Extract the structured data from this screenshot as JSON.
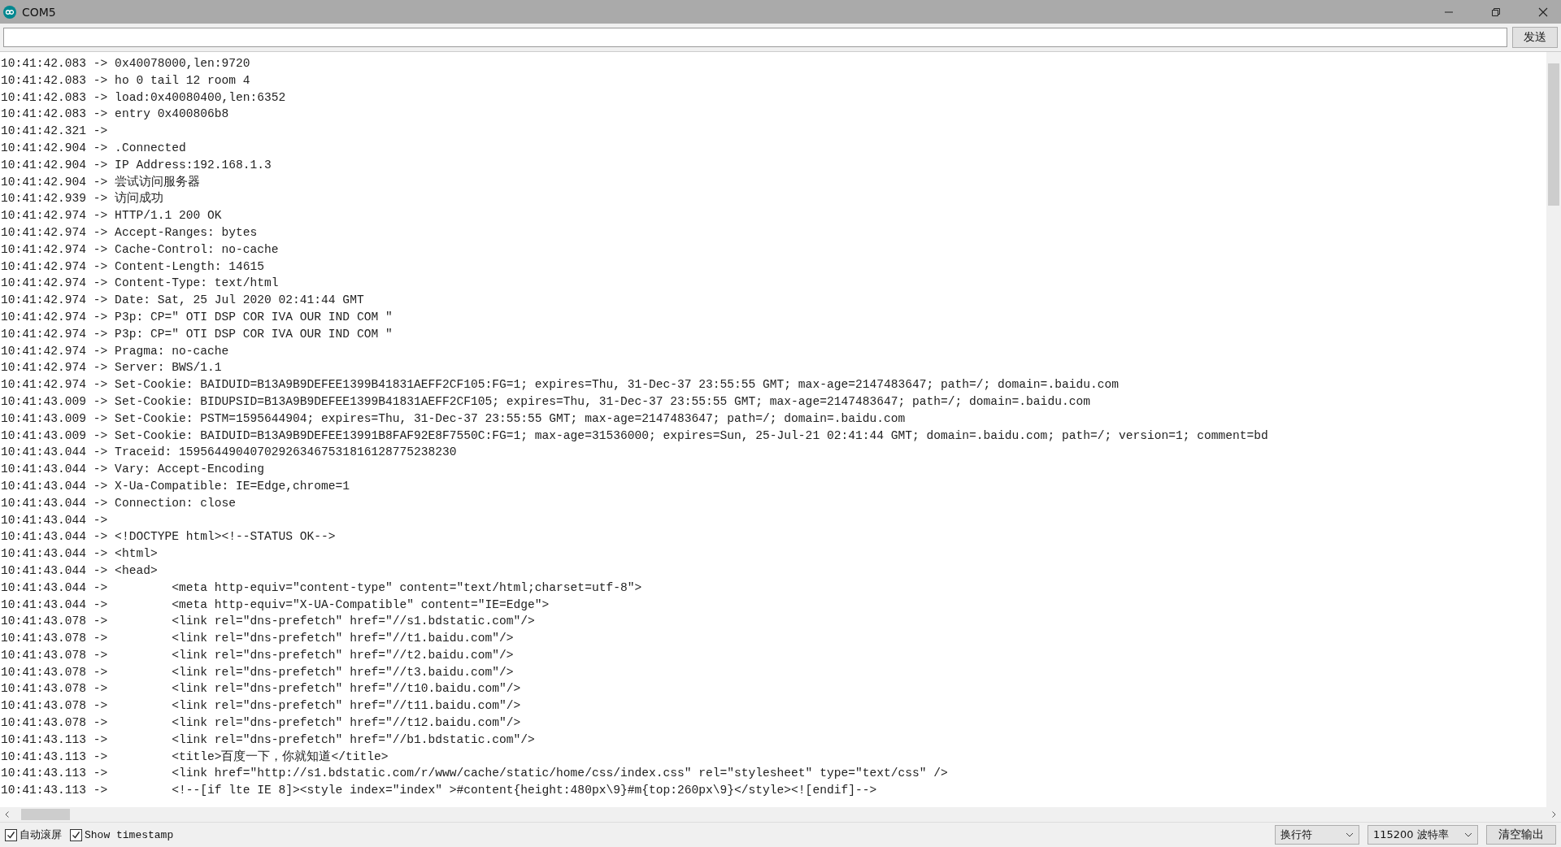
{
  "window": {
    "title": "COM5"
  },
  "input": {
    "send_button": "发送"
  },
  "output_lines": [
    "10:41:42.083 -> 0x40078000,len:9720",
    "10:41:42.083 -> ho 0 tail 12 room 4",
    "10:41:42.083 -> load:0x40080400,len:6352",
    "10:41:42.083 -> entry 0x400806b8",
    "10:41:42.321 ->",
    "10:41:42.904 -> .Connected",
    "10:41:42.904 -> IP Address:192.168.1.3",
    "10:41:42.904 -> 尝试访问服务器",
    "10:41:42.939 -> 访问成功",
    "10:41:42.974 -> HTTP/1.1 200 OK",
    "10:41:42.974 -> Accept-Ranges: bytes",
    "10:41:42.974 -> Cache-Control: no-cache",
    "10:41:42.974 -> Content-Length: 14615",
    "10:41:42.974 -> Content-Type: text/html",
    "10:41:42.974 -> Date: Sat, 25 Jul 2020 02:41:44 GMT",
    "10:41:42.974 -> P3p: CP=\" OTI DSP COR IVA OUR IND COM \"",
    "10:41:42.974 -> P3p: CP=\" OTI DSP COR IVA OUR IND COM \"",
    "10:41:42.974 -> Pragma: no-cache",
    "10:41:42.974 -> Server: BWS/1.1",
    "10:41:42.974 -> Set-Cookie: BAIDUID=B13A9B9DEFEE1399B41831AEFF2CF105:FG=1; expires=Thu, 31-Dec-37 23:55:55 GMT; max-age=2147483647; path=/; domain=.baidu.com",
    "10:41:43.009 -> Set-Cookie: BIDUPSID=B13A9B9DEFEE1399B41831AEFF2CF105; expires=Thu, 31-Dec-37 23:55:55 GMT; max-age=2147483647; path=/; domain=.baidu.com",
    "10:41:43.009 -> Set-Cookie: PSTM=1595644904; expires=Thu, 31-Dec-37 23:55:55 GMT; max-age=2147483647; path=/; domain=.baidu.com",
    "10:41:43.009 -> Set-Cookie: BAIDUID=B13A9B9DEFEE13991B8FAF92E8F7550C:FG=1; max-age=31536000; expires=Sun, 25-Jul-21 02:41:44 GMT; domain=.baidu.com; path=/; version=1; comment=bd",
    "10:41:43.044 -> Traceid: 159564490407029263467531816128775238230",
    "10:41:43.044 -> Vary: Accept-Encoding",
    "10:41:43.044 -> X-Ua-Compatible: IE=Edge,chrome=1",
    "10:41:43.044 -> Connection: close",
    "10:41:43.044 ->",
    "10:41:43.044 -> <!DOCTYPE html><!--STATUS OK-->",
    "10:41:43.044 -> <html>",
    "10:41:43.044 -> <head>",
    "10:41:43.044 ->         <meta http-equiv=\"content-type\" content=\"text/html;charset=utf-8\">",
    "10:41:43.044 ->         <meta http-equiv=\"X-UA-Compatible\" content=\"IE=Edge\">",
    "10:41:43.078 ->         <link rel=\"dns-prefetch\" href=\"//s1.bdstatic.com\"/>",
    "10:41:43.078 ->         <link rel=\"dns-prefetch\" href=\"//t1.baidu.com\"/>",
    "10:41:43.078 ->         <link rel=\"dns-prefetch\" href=\"//t2.baidu.com\"/>",
    "10:41:43.078 ->         <link rel=\"dns-prefetch\" href=\"//t3.baidu.com\"/>",
    "10:41:43.078 ->         <link rel=\"dns-prefetch\" href=\"//t10.baidu.com\"/>",
    "10:41:43.078 ->         <link rel=\"dns-prefetch\" href=\"//t11.baidu.com\"/>",
    "10:41:43.078 ->         <link rel=\"dns-prefetch\" href=\"//t12.baidu.com\"/>",
    "10:41:43.113 ->         <link rel=\"dns-prefetch\" href=\"//b1.bdstatic.com\"/>",
    "10:41:43.113 ->         <title>百度一下，你就知道</title>",
    "10:41:43.113 ->         <link href=\"http://s1.bdstatic.com/r/www/cache/static/home/css/index.css\" rel=\"stylesheet\" type=\"text/css\" />",
    "10:41:43.113 ->         <!--[if lte IE 8]><style index=\"index\" >#content{height:480px\\9}#m{top:260px\\9}</style><![endif]-->"
  ],
  "options": [
    {
      "label": "自动滚屏",
      "checked": true
    },
    {
      "label": "Show timestamp",
      "checked": true
    }
  ],
  "line_ending": "换行符",
  "baud_rate": "115200 波特率",
  "clear_button": "清空输出"
}
